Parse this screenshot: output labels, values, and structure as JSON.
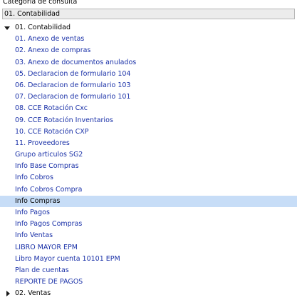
{
  "panel": {
    "label": "Categoria de consulta",
    "selected_value": "01. Contabilidad"
  },
  "tree": [
    {
      "label": "01. Contabilidad",
      "type": "group",
      "state": "expanded"
    },
    {
      "label": "01. Anexo de ventas",
      "type": "leaf"
    },
    {
      "label": "02. Anexo de compras",
      "type": "leaf"
    },
    {
      "label": "03. Anexo de documentos anulados",
      "type": "leaf"
    },
    {
      "label": "05. Declaracion de formulario 104",
      "type": "leaf"
    },
    {
      "label": "06. Declaracion de formulario 103",
      "type": "leaf"
    },
    {
      "label": "07. Declaracion de formulario 101",
      "type": "leaf"
    },
    {
      "label": "08. CCE Rotación Cxc",
      "type": "leaf"
    },
    {
      "label": "09. CCE Rotación Inventarios",
      "type": "leaf"
    },
    {
      "label": "10. CCE Rotación CXP",
      "type": "leaf"
    },
    {
      "label": "11. Proveedores",
      "type": "leaf"
    },
    {
      "label": "Grupo articulos SG2",
      "type": "leaf"
    },
    {
      "label": "Info Base Compras",
      "type": "leaf"
    },
    {
      "label": "Info Cobros",
      "type": "leaf"
    },
    {
      "label": "Info Cobros Compra",
      "type": "leaf"
    },
    {
      "label": "Info Compras",
      "type": "leaf",
      "selected": true
    },
    {
      "label": "Info Pagos",
      "type": "leaf"
    },
    {
      "label": "Info Pagos Compras",
      "type": "leaf"
    },
    {
      "label": "Info Ventas",
      "type": "leaf"
    },
    {
      "label": "LIBRO MAYOR EPM",
      "type": "leaf"
    },
    {
      "label": "Libro Mayor cuenta 10101 EPM",
      "type": "leaf"
    },
    {
      "label": "Plan de cuentas",
      "type": "leaf"
    },
    {
      "label": "REPORTE DE PAGOS",
      "type": "leaf"
    },
    {
      "label": "02. Ventas",
      "type": "group",
      "state": "collapsed"
    }
  ],
  "colors": {
    "leaf_text": "#1a31a8",
    "selection_background": "#c7ddf7",
    "combo_background": "#ececec"
  }
}
